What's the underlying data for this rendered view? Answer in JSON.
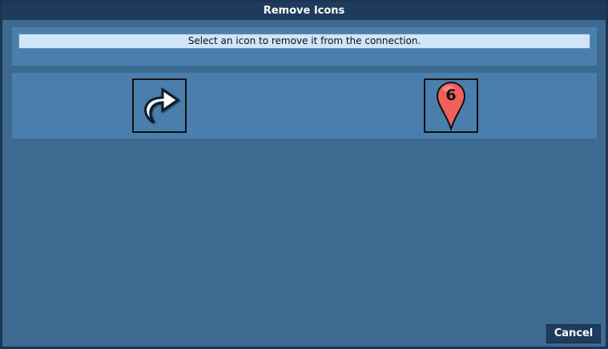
{
  "window": {
    "title": "Remove Icons"
  },
  "instruction": {
    "text": "Select an icon to remove it from the connection."
  },
  "icons": [
    {
      "name": "curved-arrow-right",
      "label": ""
    },
    {
      "name": "map-pin",
      "label": "6"
    }
  ],
  "actions": {
    "cancel_label": "Cancel"
  },
  "colors": {
    "panel": "#4a7eac",
    "background": "#3c6a90",
    "titlebar": "#1e3a5c",
    "pin": "#f2605b"
  }
}
